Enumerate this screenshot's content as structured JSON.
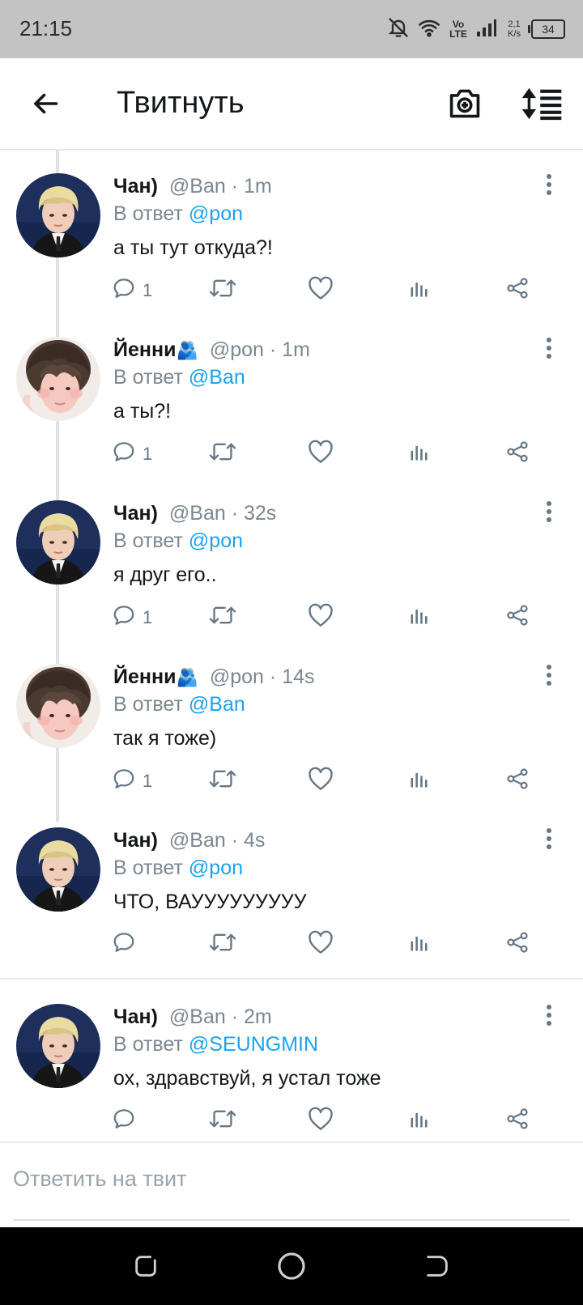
{
  "status_bar": {
    "time": "21:15",
    "icons": [
      "bell-off-icon",
      "wifi-icon",
      "volte-icon",
      "signal-icon"
    ],
    "volte_label": "Vo LTE",
    "net_speed_value": "2,1",
    "net_speed_unit": "K/s",
    "battery": "34"
  },
  "app_bar": {
    "title": "Твитнуть",
    "icons": [
      "back-arrow-icon",
      "camera-plus-icon",
      "sort-icon"
    ]
  },
  "tweets": [
    {
      "name": "Чан)",
      "handle": "@Ban",
      "time": "1m",
      "reply_prefix": "В ответ",
      "reply_to": "@pon",
      "text": "а ты тут откуда?!",
      "reply_count": "1",
      "avatar": "chan"
    },
    {
      "name": "Йенни",
      "emoji": "🫂",
      "handle": "@pon",
      "time": "1m",
      "reply_prefix": "В ответ",
      "reply_to": "@Ban",
      "text": "а ты?!",
      "reply_count": "1",
      "avatar": "yenni"
    },
    {
      "name": "Чан)",
      "handle": "@Ban",
      "time": "32s",
      "reply_prefix": "В ответ",
      "reply_to": "@pon",
      "text": "я друг его..",
      "reply_count": "1",
      "avatar": "chan"
    },
    {
      "name": "Йенни",
      "emoji": "🫂",
      "handle": "@pon",
      "time": "14s",
      "reply_prefix": "В ответ",
      "reply_to": "@Ban",
      "text": "так я тоже)",
      "reply_count": "1",
      "avatar": "yenni"
    },
    {
      "name": "Чан)",
      "handle": "@Ban",
      "time": "4s",
      "reply_prefix": "В ответ",
      "reply_to": "@pon",
      "text": "ЧТО, ВАУУУУУУУУУ",
      "reply_count": "",
      "avatar": "chan"
    },
    {
      "name": "Чан)",
      "handle": "@Ban",
      "time": "2m",
      "reply_prefix": "В ответ",
      "reply_to": "@SEUNGMIN",
      "text": "ох, здравствуй, я устал тоже",
      "reply_count": "",
      "avatar": "chan"
    }
  ],
  "reply_box": {
    "placeholder": "Ответить на твит"
  },
  "nav_bar": {
    "icons": [
      "recents-icon",
      "home-icon",
      "back-icon"
    ]
  },
  "colors": {
    "link": "#1da1f2",
    "secondary_text": "#7b8791",
    "status_bar_bg": "#c3c3c3",
    "nav_bar_bg": "#000000"
  }
}
